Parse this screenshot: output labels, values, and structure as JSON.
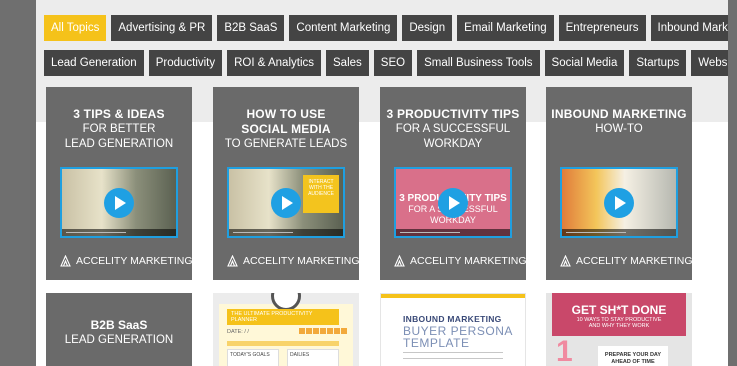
{
  "filters": {
    "row1": [
      {
        "label": "All Topics",
        "active": true
      },
      {
        "label": "Advertising & PR"
      },
      {
        "label": "B2B SaaS"
      },
      {
        "label": "Content Marketing"
      },
      {
        "label": "Design"
      },
      {
        "label": "Email Marketing"
      },
      {
        "label": "Entrepreneurs"
      },
      {
        "label": "Inbound Marketing"
      }
    ],
    "row2": [
      {
        "label": "Lead Generation"
      },
      {
        "label": "Productivity"
      },
      {
        "label": "ROI & Analytics"
      },
      {
        "label": "Sales"
      },
      {
        "label": "SEO"
      },
      {
        "label": "Small Business Tools"
      },
      {
        "label": "Social Media"
      },
      {
        "label": "Startups"
      },
      {
        "label": "Websites"
      }
    ]
  },
  "brand": "ACCELITY MARKETING",
  "cards": [
    {
      "line1": "3 TIPS & IDEAS",
      "line2": "FOR BETTER",
      "line3": "LEAD GENERATION"
    },
    {
      "line1": "HOW TO USE",
      "line2": "SOCIAL MEDIA",
      "line3": "TO GENERATE LEADS",
      "overlay": "INTERACT WITH THE AUDIENCE"
    },
    {
      "line1": "3 PRODUCTIVITY TIPS",
      "line2": "FOR A SUCCESSFUL",
      "line3": "WORKDAY",
      "thumb_text1": "3 PRODUCTIVITY TIPS",
      "thumb_text2": "FOR A SUCCESSFUL",
      "thumb_text3": "WORKDAY"
    },
    {
      "line1": "INBOUND MARKETING",
      "line2": "HOW-TO",
      "line3": ""
    }
  ],
  "second_row": {
    "b2b": {
      "line1": "B2B SaaS",
      "line2": "LEAD GENERATION"
    },
    "planner": {
      "title": "THE ULTIMATE PRODUCTIVITY PLANNER",
      "date": "DATE:  /  /",
      "col1": "TODAY'S GOALS",
      "col2": "DAILIES"
    },
    "persona": {
      "line1": "INBOUND MARKETING",
      "line2": "BUYER PERSONA",
      "line3": "TEMPLATE"
    },
    "gsd": {
      "title": "GET SH*T DONE",
      "sub1": "10 WAYS TO STAY PRODUCTIVE",
      "sub2": "AND WHY THEY WORK",
      "number": "1",
      "box1": "PREPARE YOUR DAY",
      "box2": "AHEAD OF TIME"
    }
  }
}
